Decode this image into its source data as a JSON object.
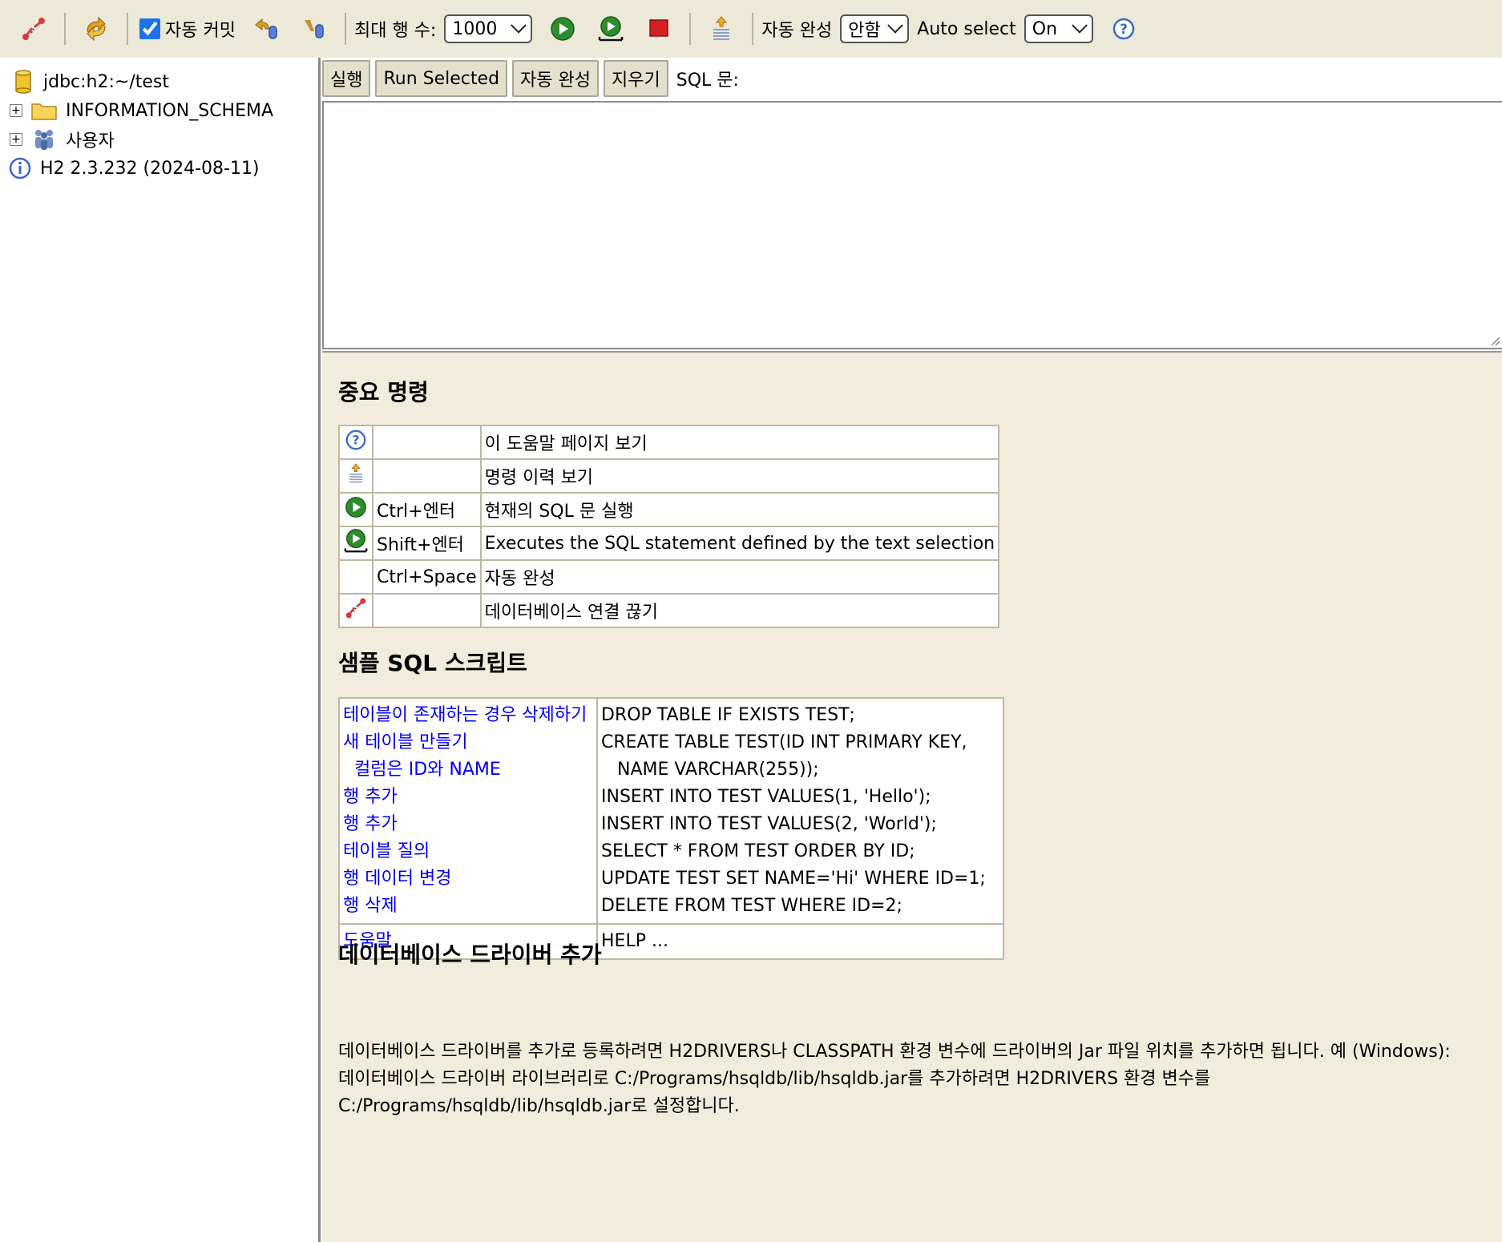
{
  "toolbar": {
    "autocommit_label": "자동 커밋",
    "autocommit_checked": true,
    "maxrows_label": "최대 행 수:",
    "maxrows_value": "1000",
    "autocomplete_label": "자동 완성",
    "autocomplete_value": "안함",
    "autoselect_label": "Auto select",
    "autoselect_value": "On"
  },
  "sidebar": {
    "connection": "jdbc:h2:~/test",
    "schema": "INFORMATION_SCHEMA",
    "users": "사용자",
    "version": "H2 2.3.232 (2024-08-11)"
  },
  "editor_bar": {
    "run": "실행",
    "run_selected": "Run Selected",
    "autocomplete": "자동 완성",
    "clear": "지우기",
    "sql_label": "SQL 문:"
  },
  "help": {
    "important_title": "중요 명령",
    "commands": [
      {
        "icon": "help-icon",
        "key": "",
        "desc": "이 도움말 페이지 보기"
      },
      {
        "icon": "history-icon",
        "key": "",
        "desc": "명령 이력 보기"
      },
      {
        "icon": "run-icon",
        "key": "Ctrl+엔터",
        "desc": "현재의 SQL 문 실행"
      },
      {
        "icon": "run-selected-icon",
        "key": "Shift+엔터",
        "desc": "Executes the SQL statement defined by the text selection"
      },
      {
        "icon": "",
        "key": "Ctrl+Space",
        "desc": "자동 완성"
      },
      {
        "icon": "disconnect-icon",
        "key": "",
        "desc": "데이터베이스 연결 끊기"
      }
    ],
    "sample_title": "샘플 SQL 스크립트",
    "samples": [
      {
        "label": "테이블이 존재하는 경우 삭제하기",
        "sql": "DROP TABLE IF EXISTS TEST;"
      },
      {
        "label": "새 테이블 만들기",
        "sql": "CREATE TABLE TEST(ID INT PRIMARY KEY,"
      },
      {
        "label": "컬럼은 ID와 NAME",
        "sql": "NAME VARCHAR(255));"
      },
      {
        "label": "행 추가",
        "sql": "INSERT INTO TEST VALUES(1, 'Hello');"
      },
      {
        "label": "행 추가",
        "sql": "INSERT INTO TEST VALUES(2, 'World');"
      },
      {
        "label": "테이블 질의",
        "sql": "SELECT * FROM TEST ORDER BY ID;"
      },
      {
        "label": "행 데이터 변경",
        "sql": "UPDATE TEST SET NAME='Hi' WHERE ID=1;"
      },
      {
        "label": "행 삭제",
        "sql": "DELETE FROM TEST WHERE ID=2;"
      }
    ],
    "help_link": "도움말",
    "help_sql": "HELP ...",
    "driver_title": "데이터베이스 드라이버 추가",
    "driver_lines": [
      "데이터베이스 드라이버를 추가로 등록하려면 H2DRIVERS나 CLASSPATH 환경 변수에 드라이버의 Jar 파일 위치를 추가하면 됩니다. 예 (Windows):",
      "데이터베이스 드라이버 라이브러리로 C:/Programs/hsqldb/lib/hsqldb.jar를 추가하려면 H2DRIVERS 환경 변수를",
      "C:/Programs/hsqldb/lib/hsqldb.jar로 설정합니다."
    ]
  },
  "colors": {
    "toolbar_bg": "#ece9d8",
    "help_bg": "#f1ecdc",
    "link": "#0000ee",
    "run_green": "#2e8b2e",
    "stop_red": "#d42020"
  }
}
